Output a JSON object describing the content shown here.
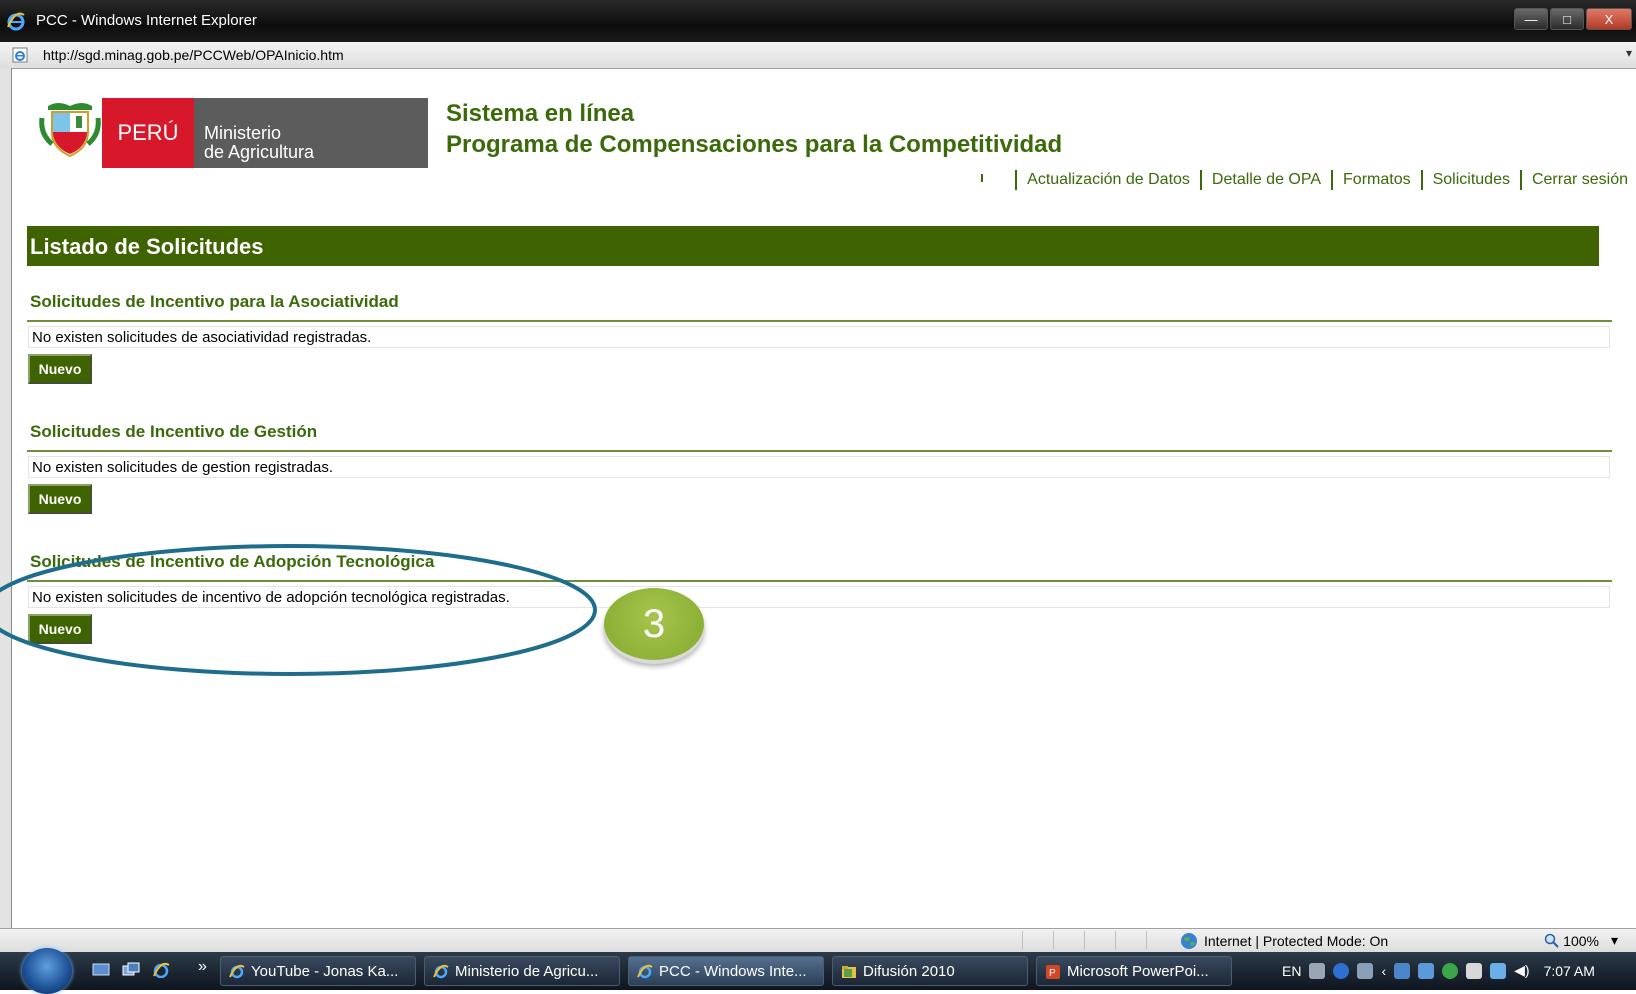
{
  "window": {
    "title": "PCC - Windows Internet Explorer",
    "address": "http://sgd.minag.gob.pe/PCCWeb/OPAInicio.htm",
    "minimize_symbol": "—",
    "maximize_symbol": "□",
    "close_symbol": "X"
  },
  "logo": {
    "country": "PERÚ",
    "ministry_line1": "Ministerio",
    "ministry_line2": "de Agricultura"
  },
  "header": {
    "title_line1": "Sistema en línea",
    "title_line2": "Programa de Compensaciones para la Competitividad"
  },
  "nav": {
    "items": [
      "Actualización de Datos",
      "Detalle de OPA",
      "Formatos",
      "Solicitudes",
      "Cerrar sesión"
    ]
  },
  "main": {
    "heading": "Listado de Solicitudes",
    "sections": [
      {
        "title": "Solicitudes de Incentivo para la Asociatividad",
        "message": "No existen solicitudes de asociatividad registradas.",
        "button": "Nuevo"
      },
      {
        "title": "Solicitudes de Incentivo de Gestión",
        "message": "No existen solicitudes de gestion registradas.",
        "button": "Nuevo"
      },
      {
        "title": "Solicitudes de Incentivo de Adopción Tecnológica",
        "message": "No existen solicitudes de incentivo de adopción tecnológica registradas.",
        "button": "Nuevo"
      }
    ]
  },
  "annotation": {
    "badge_number": "3",
    "ellipse_color": "#1f6d8c",
    "badge_color": "#8db136"
  },
  "statusbar": {
    "zone": "Internet | Protected Mode: On",
    "zoom": "100%"
  },
  "taskbar": {
    "tasks": [
      "YouTube - Jonas Ka...",
      "Ministerio de Agricu...",
      "PCC - Windows Inte...",
      "Difusión 2010",
      "Microsoft PowerPoi..."
    ],
    "overflow": "»",
    "language": "EN",
    "clock": "7:07 AM"
  },
  "colors": {
    "brand_green": "#3f6300",
    "text_green": "#3a6a0a",
    "peru_red": "#d7182a"
  },
  "icons": {
    "ie": "ie-icon",
    "shield": "peru-shield-icon",
    "globe": "globe-icon",
    "zoom": "magnifier-icon",
    "start": "windows-start-icon"
  }
}
